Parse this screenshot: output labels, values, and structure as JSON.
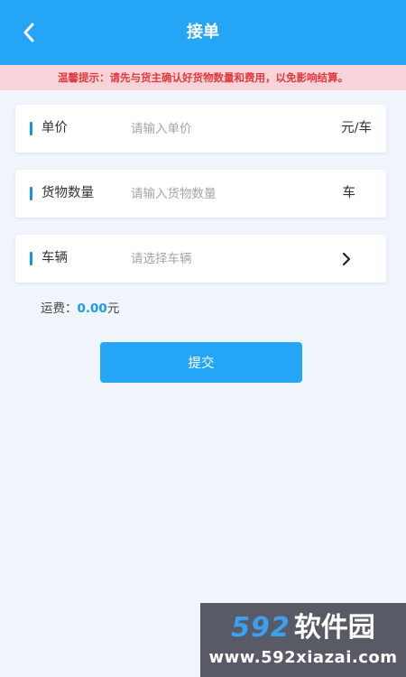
{
  "header": {
    "title": "接单",
    "back_icon": "chevron-left-icon"
  },
  "notice": {
    "text": "温馨提示：请先与货主确认好货物数量和费用，以免影响结算。"
  },
  "form": {
    "unit_price": {
      "label": "单价",
      "placeholder": "请输入单价",
      "unit": "元/车"
    },
    "quantity": {
      "label": "货物数量",
      "placeholder": "请输入货物数量",
      "unit": "车"
    },
    "vehicle": {
      "label": "车辆",
      "placeholder": "请选择车辆",
      "icon": "chevron-right-icon"
    }
  },
  "fee": {
    "label": "运费：",
    "amount": "0.00",
    "currency": "元"
  },
  "submit": {
    "label": "提交"
  },
  "watermark": {
    "number": "592",
    "brand": "软件园",
    "url": "www.592xiazai.com"
  },
  "colors": {
    "primary": "#24a5f5",
    "notice_bg": "#f7d4d9",
    "notice_text": "#e23a3e",
    "page_bg": "#f0f4fb"
  }
}
